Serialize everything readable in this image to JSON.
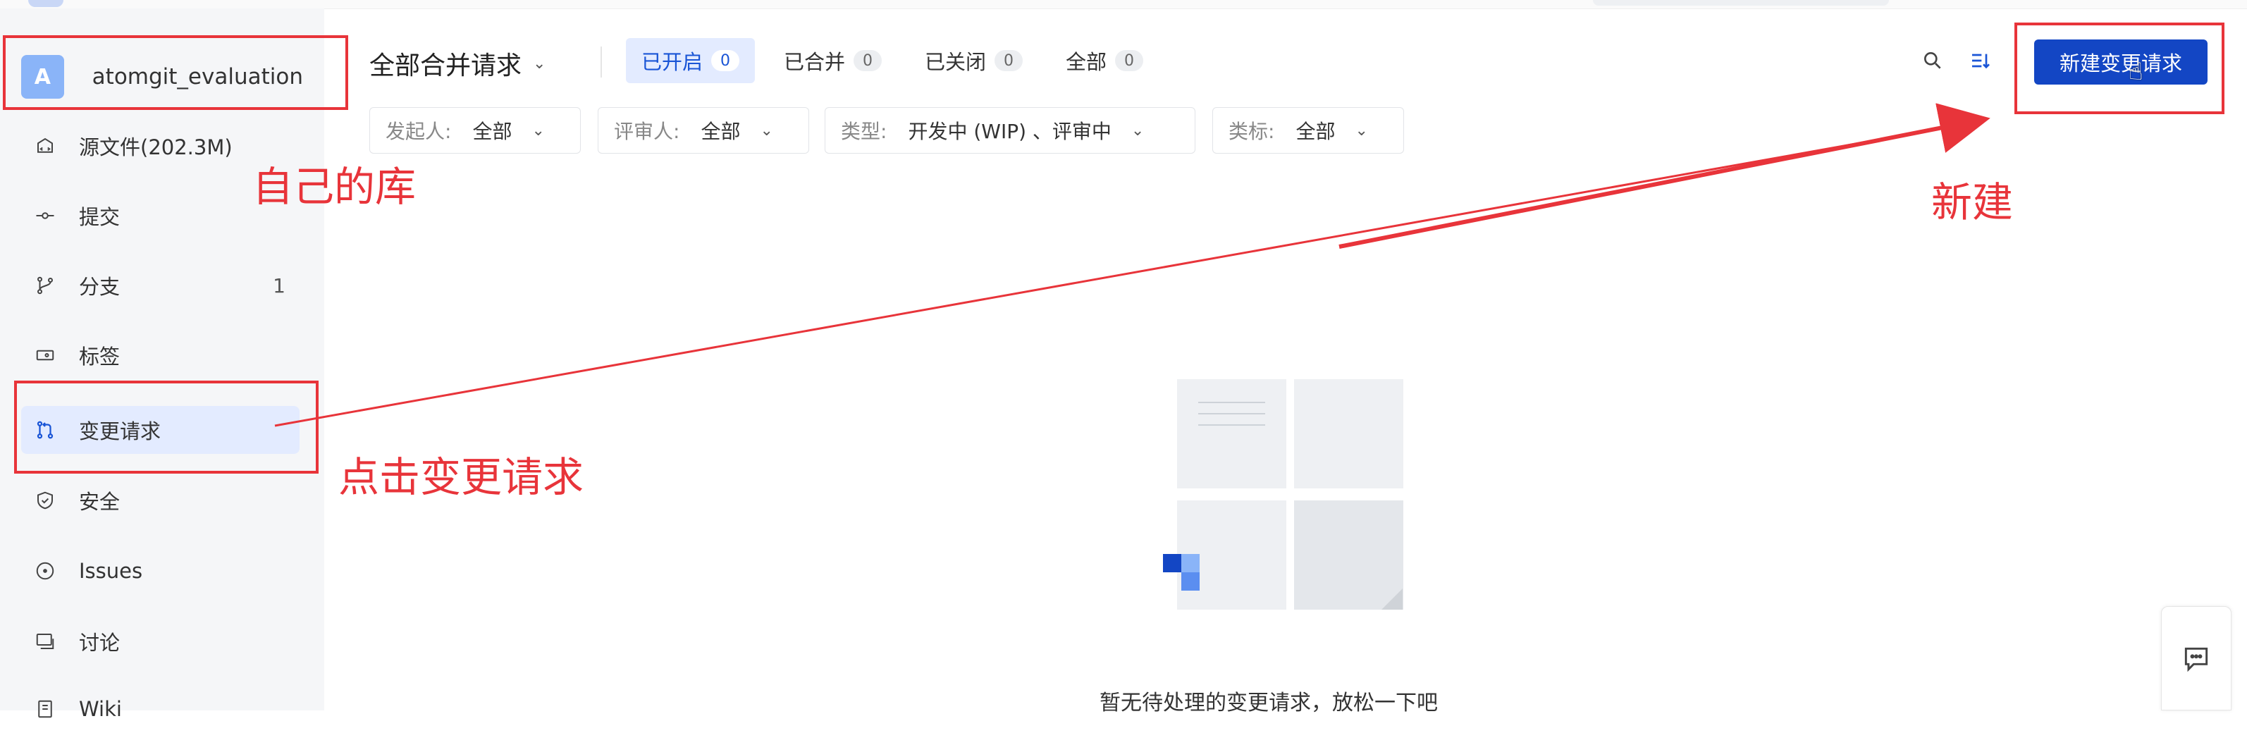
{
  "repo": {
    "avatar_letter": "A",
    "name": "atomgit_evaluation"
  },
  "sidebar": {
    "items": [
      {
        "label": "源文件(202.3M)",
        "icon": "folder-code-icon",
        "count": ""
      },
      {
        "label": "提交",
        "icon": "commit-icon",
        "count": ""
      },
      {
        "label": "分支",
        "icon": "branch-icon",
        "count": "1"
      },
      {
        "label": "标签",
        "icon": "tag-icon",
        "count": ""
      },
      {
        "label": "变更请求",
        "icon": "merge-request-icon",
        "count": "",
        "active": true
      },
      {
        "label": "安全",
        "icon": "shield-icon",
        "count": ""
      },
      {
        "label": "Issues",
        "icon": "issue-icon",
        "count": ""
      },
      {
        "label": "讨论",
        "icon": "discussion-icon",
        "count": ""
      },
      {
        "label": "Wiki",
        "icon": "wiki-icon",
        "count": ""
      }
    ]
  },
  "header": {
    "title": "全部合并请求",
    "tabs": [
      {
        "label": "已开启",
        "count": "0",
        "active": true
      },
      {
        "label": "已合并",
        "count": "0"
      },
      {
        "label": "已关闭",
        "count": "0"
      },
      {
        "label": "全部",
        "count": "0"
      }
    ],
    "new_button": "新建变更请求"
  },
  "filters": [
    {
      "key": "发起人:",
      "value": "全部"
    },
    {
      "key": "评审人:",
      "value": "全部"
    },
    {
      "key": "类型:",
      "value": "开发中 (WIP) 、评审中"
    },
    {
      "key": "类标:",
      "value": "全部"
    }
  ],
  "empty_state": {
    "text": "暂无待处理的变更请求，放松一下吧"
  },
  "annotations": {
    "own_repo": "自己的库",
    "click_mr": "点击变更请求",
    "new": "新建"
  },
  "colors": {
    "accent": "#1346c4",
    "annotation": "#e8343a",
    "active_bg": "#e3ebff"
  }
}
